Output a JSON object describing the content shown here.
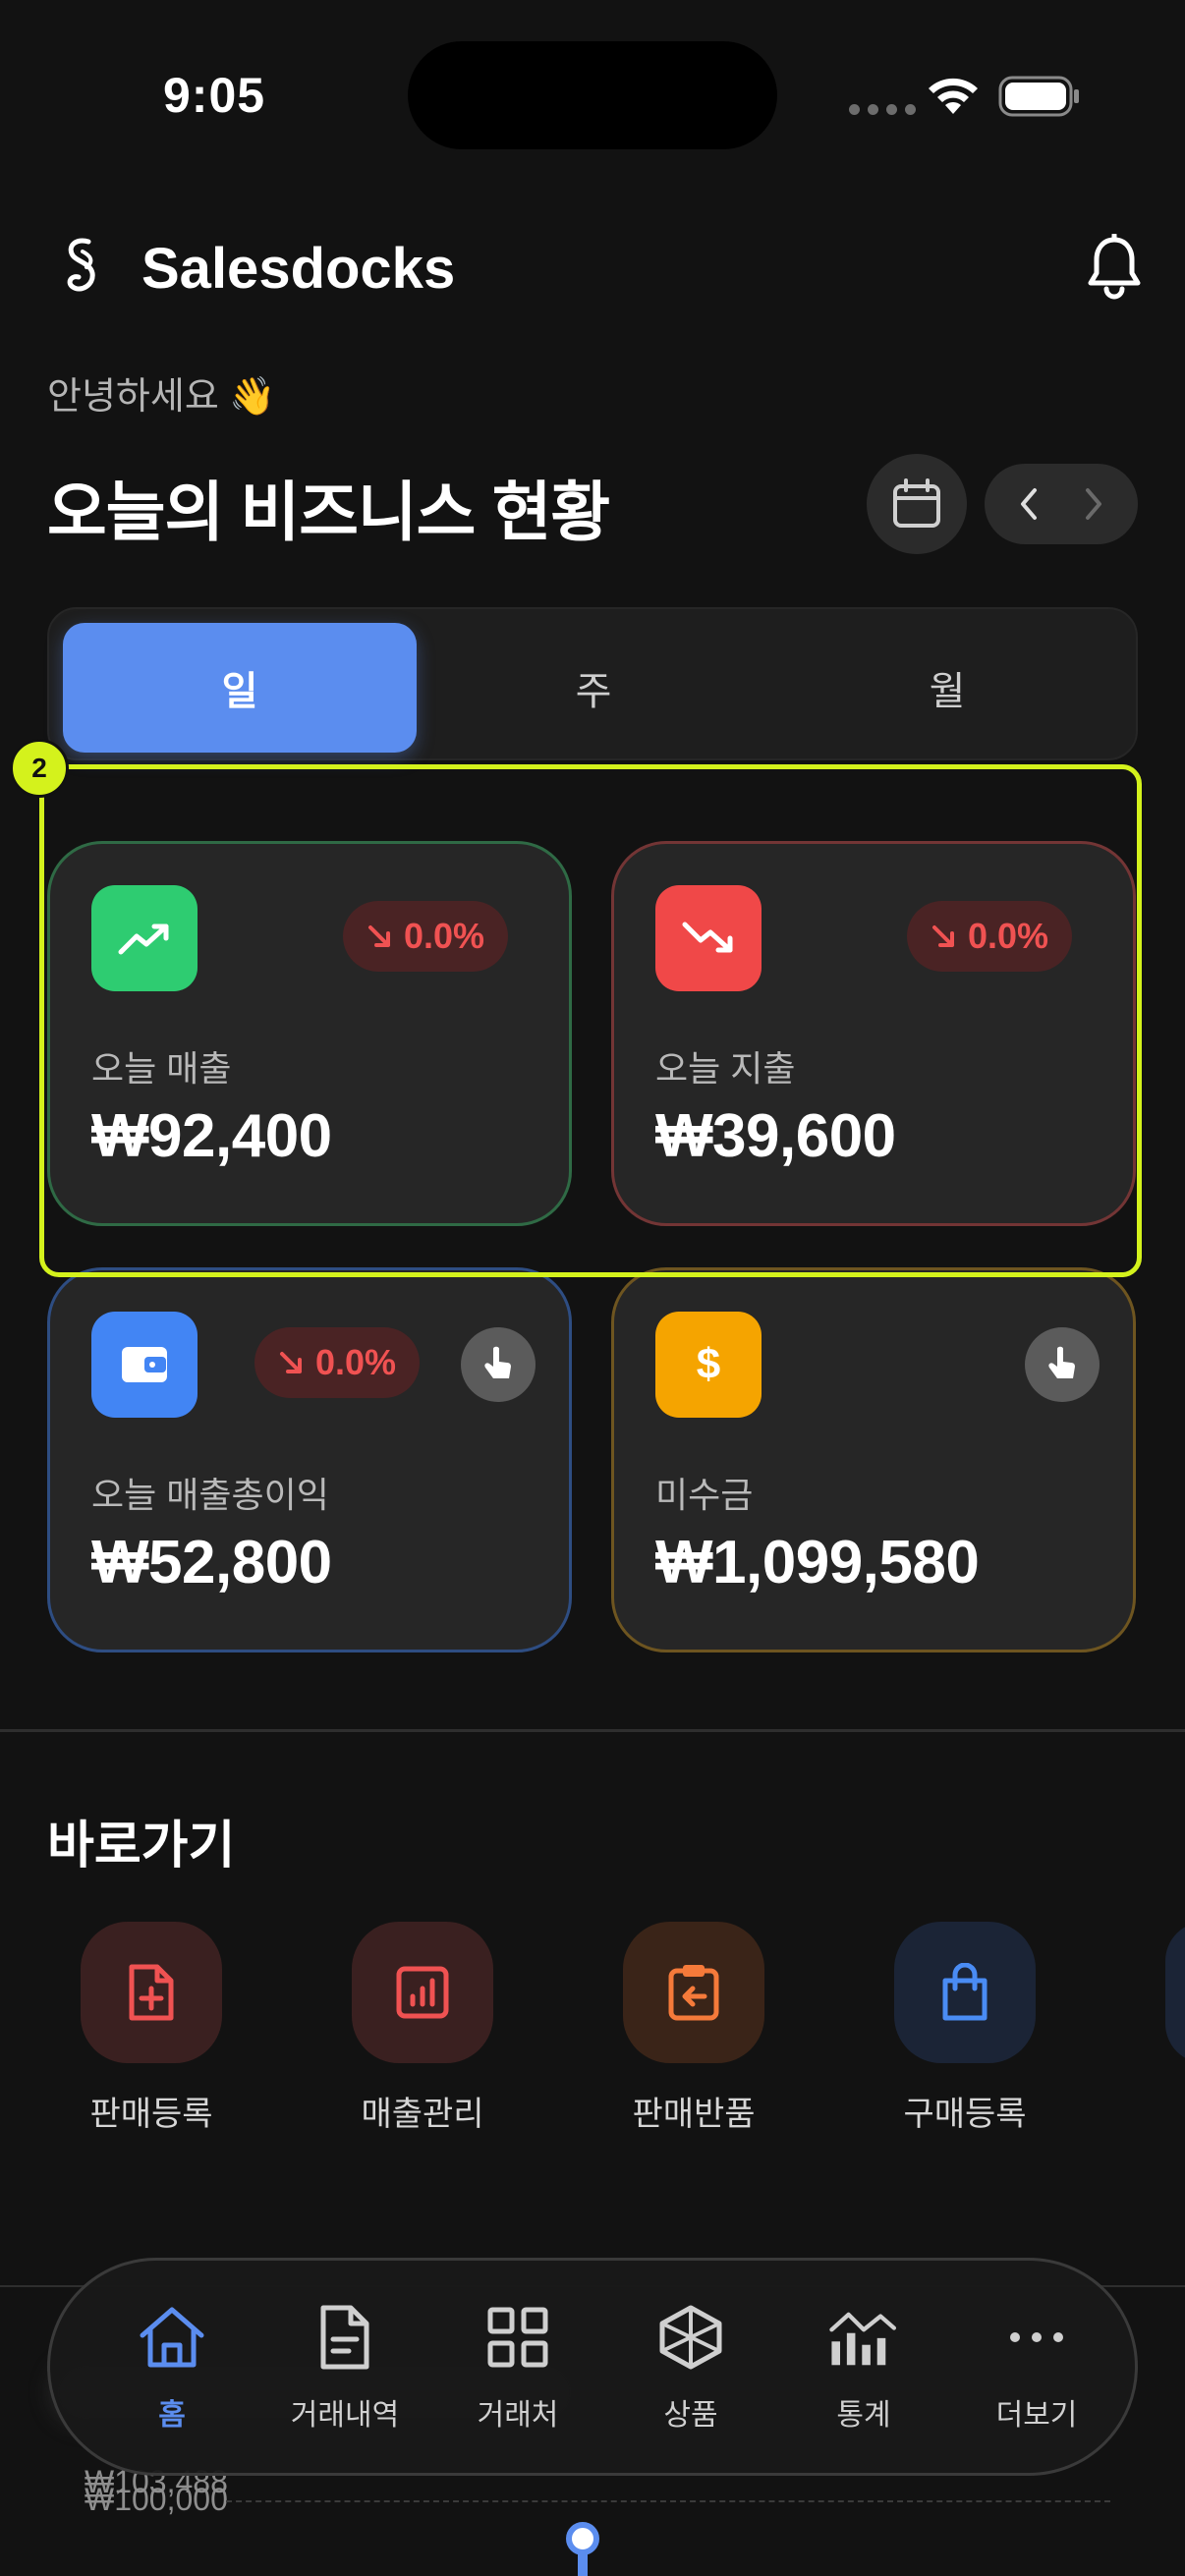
{
  "status_bar": {
    "time": "9:05"
  },
  "header": {
    "app_name": "Salesdocks"
  },
  "greeting": "안녕하세요 👋",
  "page_title": "오늘의 비즈니스 현황",
  "period_tabs": [
    {
      "label": "일",
      "active": true
    },
    {
      "label": "주",
      "active": false
    },
    {
      "label": "월",
      "active": false
    }
  ],
  "highlight_badge": "2",
  "cards": {
    "sales": {
      "label": "오늘 매출",
      "value": "₩92,400",
      "change": "0.0%",
      "icon": "trending-up-icon",
      "icon_color": "#2ecc71"
    },
    "expense": {
      "label": "오늘 지출",
      "value": "₩39,600",
      "change": "0.0%",
      "icon": "trending-down-icon",
      "icon_color": "#f04848"
    },
    "gross_profit": {
      "label": "오늘 매출총이익",
      "value": "₩52,800",
      "change": "0.0%",
      "icon": "wallet-icon",
      "icon_color": "#4285f4"
    },
    "receivables": {
      "label": "미수금",
      "value": "₩1,099,580",
      "icon": "dollar-icon",
      "icon_color": "#f5a400"
    }
  },
  "shortcuts": {
    "title": "바로가기",
    "items": [
      {
        "label": "판매등록",
        "icon": "file-plus-icon"
      },
      {
        "label": "매출관리",
        "icon": "report-chart-icon"
      },
      {
        "label": "판매반품",
        "icon": "clipboard-return-icon"
      },
      {
        "label": "구매등록",
        "icon": "shopping-bag-icon"
      }
    ]
  },
  "peek": {
    "value1": "₩103,488",
    "value2": "₩100,000"
  },
  "tab_bar": [
    {
      "label": "홈",
      "icon": "home-icon",
      "active": true
    },
    {
      "label": "거래내역",
      "icon": "document-icon",
      "active": false
    },
    {
      "label": "거래처",
      "icon": "grid-icon",
      "active": false
    },
    {
      "label": "상품",
      "icon": "box-icon",
      "active": false
    },
    {
      "label": "통계",
      "icon": "stats-icon",
      "active": false
    },
    {
      "label": "더보기",
      "icon": "more-icon",
      "active": false
    }
  ],
  "colors": {
    "accent": "#5b8def",
    "highlight": "#d4f21c",
    "negative": "#f05252"
  }
}
